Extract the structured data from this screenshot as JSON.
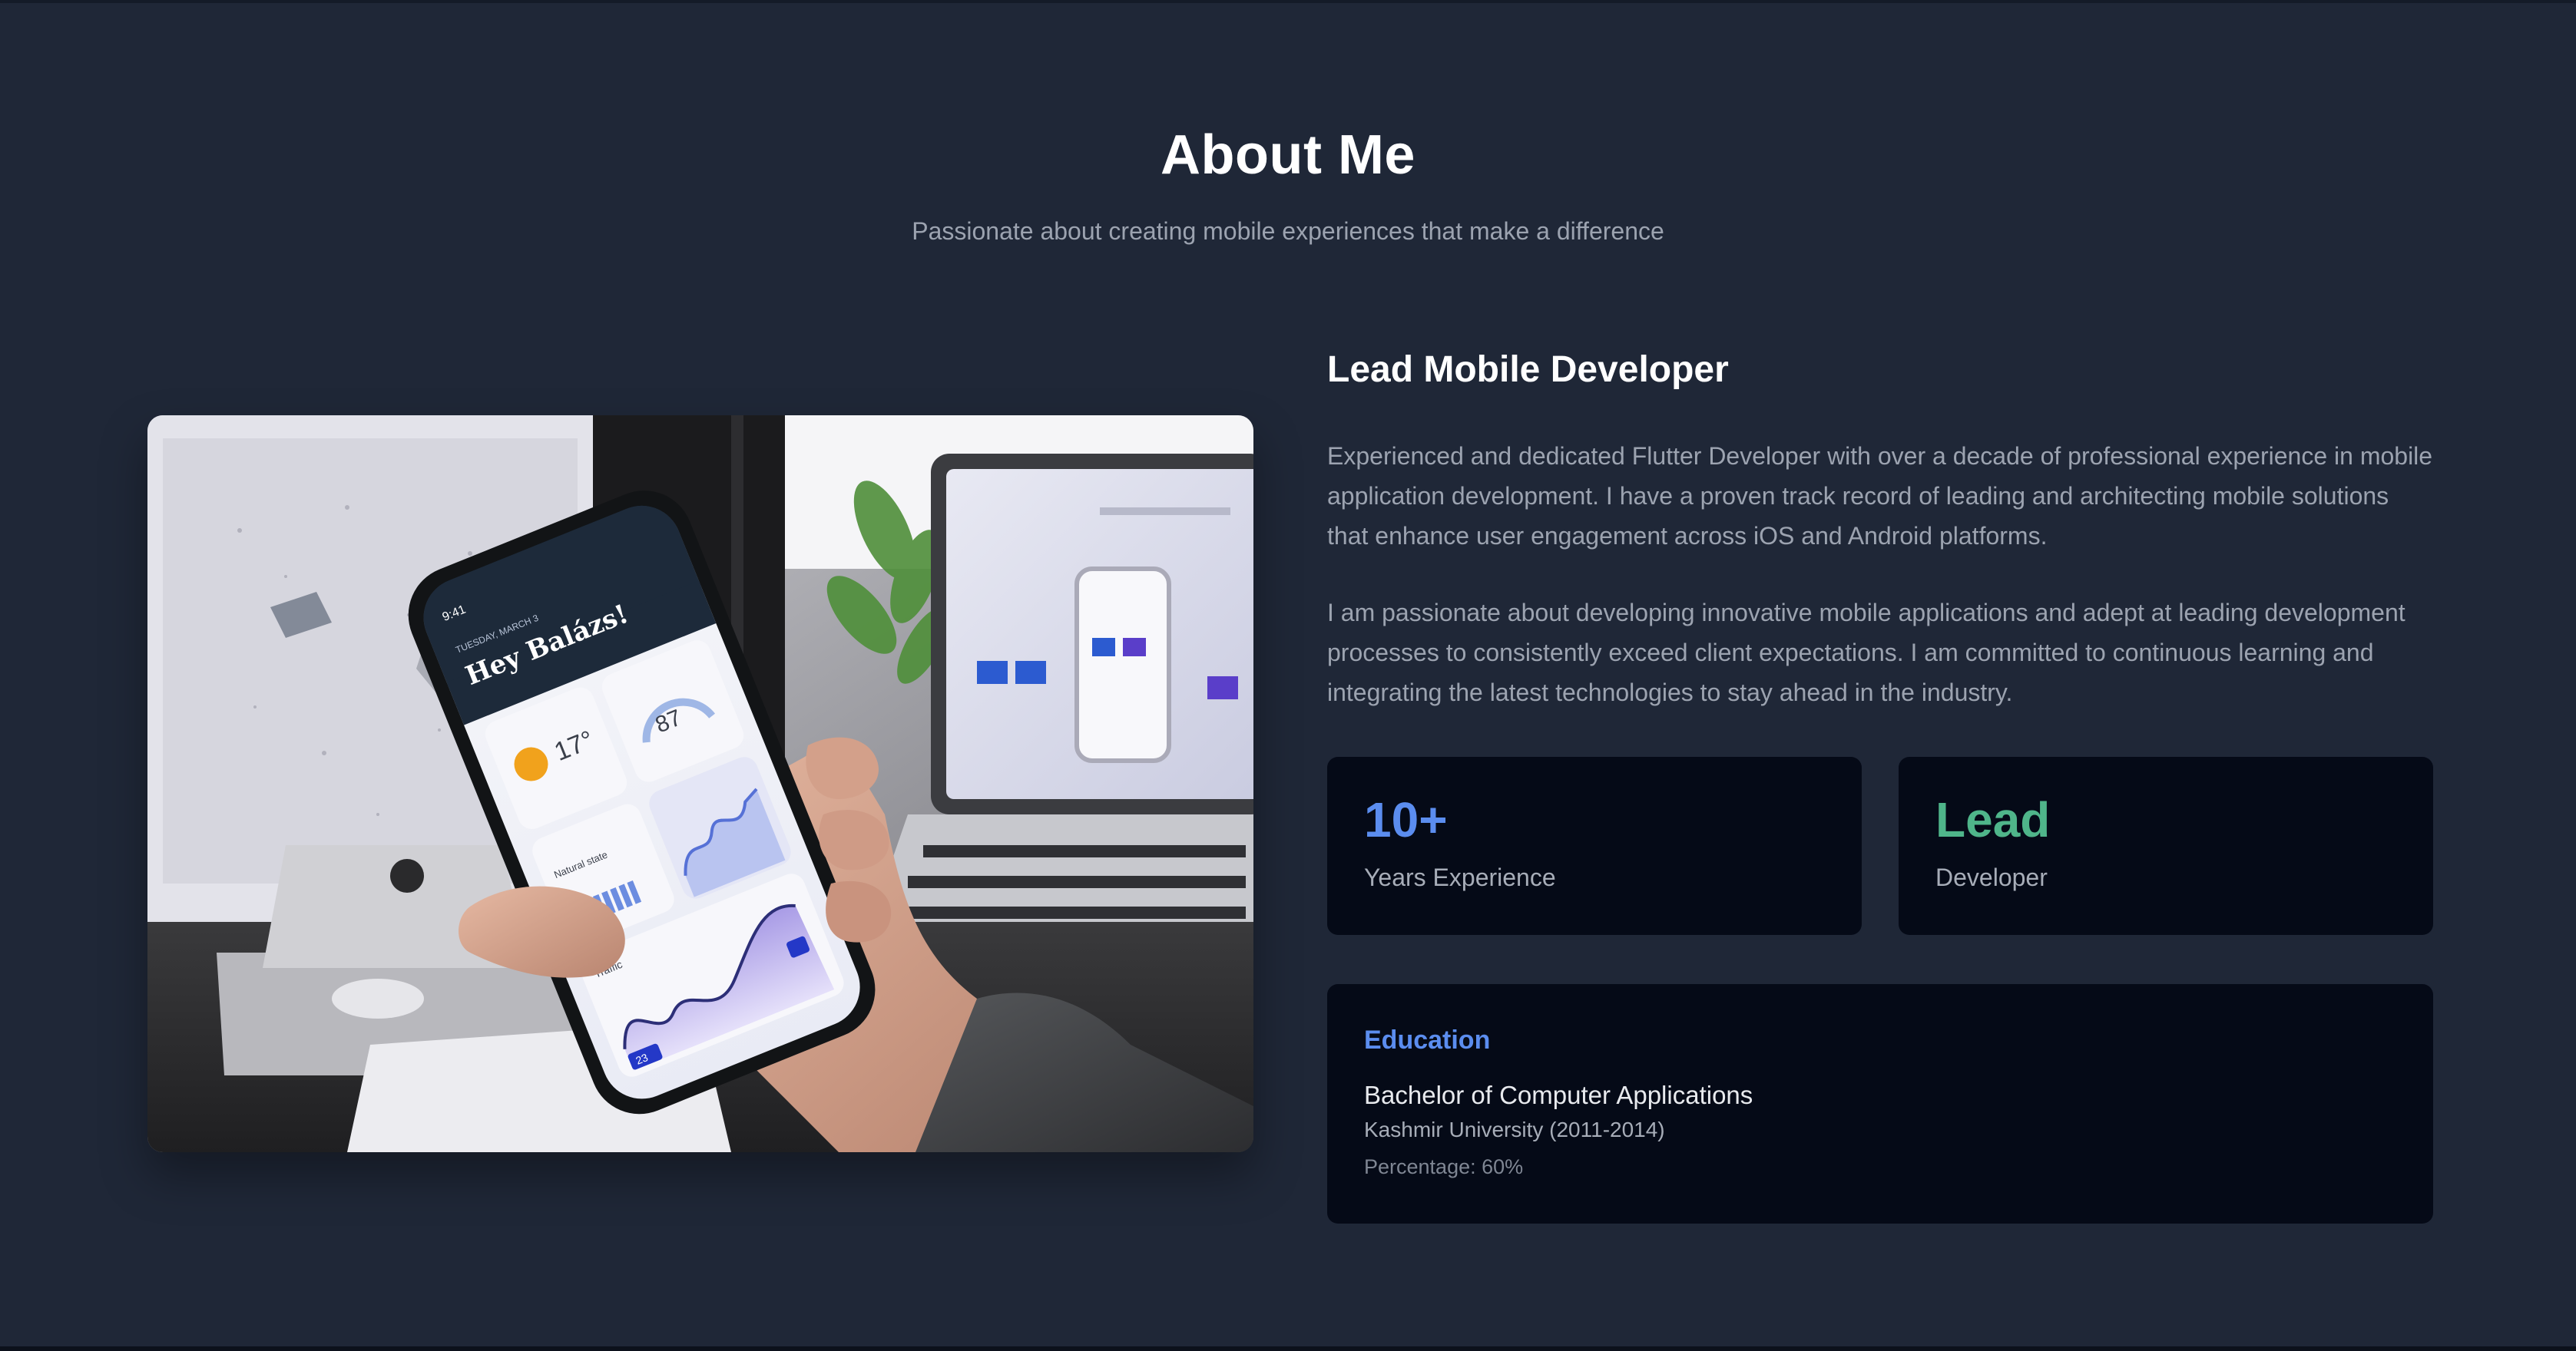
{
  "section": {
    "title": "About Me",
    "subtitle": "Passionate about creating mobile experiences that make a difference"
  },
  "photo": {
    "phone_greeting": "Hey Balázs!",
    "phone_time": "9:41",
    "phone_date": "TUESDAY, MARCH 3",
    "weather_temp": "17°",
    "air_quality_value": "87",
    "water_quality_label": "Natural state",
    "traffic_label": "Traffic",
    "crowd_value": "23"
  },
  "profile": {
    "role_title": "Lead Mobile Developer",
    "bio_paragraph_1": "Experienced and dedicated Flutter Developer with over a decade of professional experience in mobile application development. I have a proven track record of leading and architecting mobile solutions that enhance user engagement across iOS and Android platforms.",
    "bio_paragraph_2": "I am passionate about developing innovative mobile applications and adept at leading development processes to consistently exceed client expectations. I am committed to continuous learning and integrating the latest technologies to stay ahead in the industry."
  },
  "stats": [
    {
      "value": "10+",
      "label": "Years Experience",
      "color": "#5b8def"
    },
    {
      "value": "Lead",
      "label": "Developer",
      "color": "#4fb58a"
    }
  ],
  "education": {
    "heading": "Education",
    "degree": "Bachelor of Computer Applications",
    "school": "Kashmir University (2011-2014)",
    "percentage": "Percentage: 60%"
  },
  "theme": {
    "background": "#1f2737",
    "card_background": "#050a17",
    "accent_blue": "#5b8def",
    "accent_green": "#4fb58a",
    "muted_text": "#9ca3b0"
  }
}
